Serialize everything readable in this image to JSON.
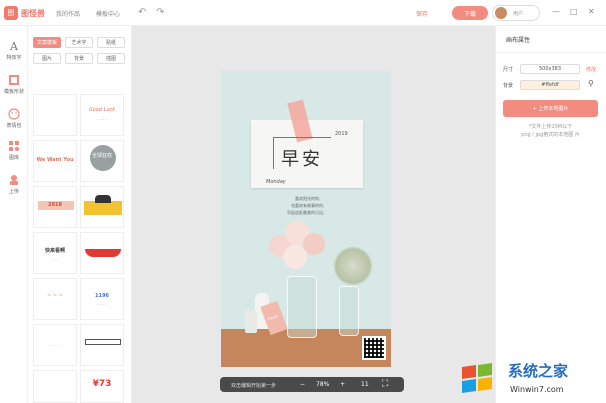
{
  "header": {
    "logo_text": "图怪兽",
    "logo_mark": "图",
    "nav": [
      "我的作品",
      "模板中心"
    ],
    "save_label": "保存",
    "download_label": "下载",
    "user_label": "用户"
  },
  "rail": [
    {
      "label": "特效字"
    },
    {
      "label": "模板形状"
    },
    {
      "label": "表情包"
    },
    {
      "label": "图库"
    },
    {
      "label": "上传"
    }
  ],
  "template_chips": [
    "文案模板",
    "艺术字",
    "贴纸",
    "图片",
    "背景",
    "插图"
  ],
  "thumbnails": [
    {
      "text": "Good Luck"
    },
    {
      "text": "We Want You"
    },
    {
      "text": "全球狂欢"
    },
    {
      "text": "2018"
    },
    {
      "text": "快来看啊"
    },
    {
      "text": "1196"
    },
    {
      "text": "¥73"
    }
  ],
  "poster": {
    "year": "2019",
    "title": "早安",
    "weekday": "Monday",
    "lines": [
      "喜欢阳光的你,",
      "也喜欢有故事的你,",
      "早起追赶最美的日出,"
    ],
    "tag_text": "Fresh"
  },
  "zoom": {
    "hint": "双击编辑开始第一步",
    "minus": "−",
    "level": "78%",
    "plus": "+",
    "extra": "11"
  },
  "right_panel": {
    "title": "画布属性",
    "size_label": "尺寸",
    "size_value": "500x383",
    "size_action": "修改",
    "bg_label": "背景",
    "bg_value": "#ffefdf",
    "upload_label": "+ 上传本地图片",
    "hint1": "*文件上传20M以下",
    "hint2": "png / jpg格式的本地图 片"
  },
  "watermark": {
    "text1": "系统之家",
    "text2": "Winwin7.com"
  },
  "colors": {
    "accent": "#f28b80",
    "accent_dark": "#f07a6e"
  }
}
